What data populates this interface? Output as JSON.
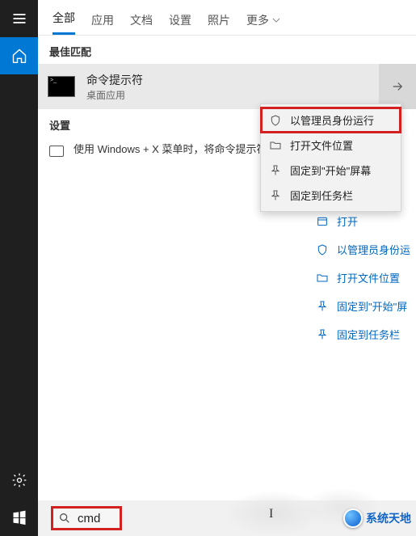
{
  "rail": {
    "menu": "menu",
    "home": "home",
    "settings": "settings",
    "start": "start"
  },
  "tabs": {
    "all": "全部",
    "apps": "应用",
    "docs": "文档",
    "settings": "设置",
    "photos": "照片",
    "more": "更多"
  },
  "best_match_label": "最佳匹配",
  "result": {
    "title": "命令提示符",
    "subtitle": "桌面应用"
  },
  "settings_section": "设置",
  "settings_option": "使用 Windows + X 菜单时，将命令提示符替换为 Windows",
  "context_menu": {
    "run_admin": "以管理员身份运行",
    "open_location": "打开文件位置",
    "pin_start": "固定到\"开始\"屏幕",
    "pin_taskbar": "固定到任务栏"
  },
  "right_actions": {
    "open": "打开",
    "run_admin": "以管理员身份运",
    "open_location": "打开文件位置",
    "pin_start": "固定到\"开始\"屏",
    "pin_taskbar": "固定到任务栏"
  },
  "search": {
    "value": "cmd"
  },
  "watermark": "系统天地"
}
